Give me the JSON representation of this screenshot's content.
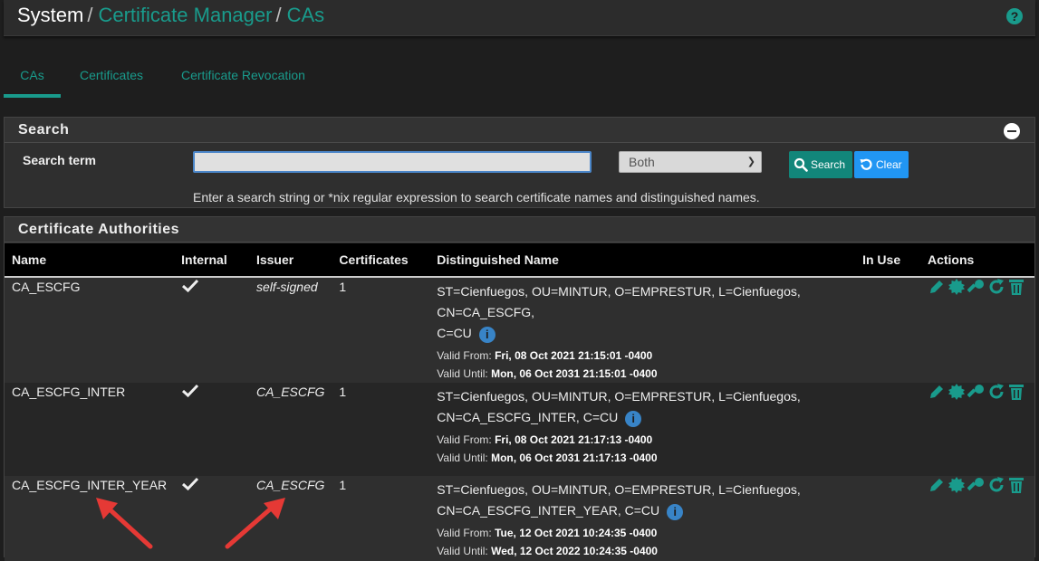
{
  "breadcrumb": {
    "root": "System",
    "sep1": "/",
    "item1": "Certificate Manager",
    "sep2": "/",
    "item2": "CAs"
  },
  "tabs": [
    {
      "label": "CAs",
      "active": true
    },
    {
      "label": "Certificates",
      "active": false
    },
    {
      "label": "Certificate Revocation",
      "active": false
    }
  ],
  "search": {
    "title": "Search",
    "label": "Search term",
    "value": "",
    "select_value": "Both",
    "search_button": "Search",
    "clear_button": "Clear",
    "help": "Enter a search string or *nix regular expression to search certificate names and distinguished names."
  },
  "ca_panel": {
    "title": "Certificate Authorities",
    "columns": [
      "Name",
      "Internal",
      "Issuer",
      "Certificates",
      "Distinguished Name",
      "In Use",
      "Actions"
    ],
    "rows": [
      {
        "name": "CA_ESCFG",
        "internal": true,
        "issuer": "self-signed",
        "certificates": "1",
        "dn_line1": "ST=Cienfuegos, OU=MINTUR, O=EMPRESTUR, L=Cienfuegos, CN=CA_ESCFG,",
        "dn_line2": "C=CU",
        "valid_from_label": "Valid From:",
        "valid_from": "Fri, 08 Oct 2021 21:15:01 -0400",
        "valid_until_label": "Valid Until:",
        "valid_until": "Mon, 06 Oct 2031 21:15:01 -0400"
      },
      {
        "name": "CA_ESCFG_INTER",
        "internal": true,
        "issuer": "CA_ESCFG",
        "certificates": "1",
        "dn_line1": "ST=Cienfuegos, OU=MINTUR, O=EMPRESTUR, L=Cienfuegos,",
        "dn_line2": "CN=CA_ESCFG_INTER, C=CU",
        "valid_from_label": "Valid From:",
        "valid_from": "Fri, 08 Oct 2021 21:17:13 -0400",
        "valid_until_label": "Valid Until:",
        "valid_until": "Mon, 06 Oct 2031 21:17:13 -0400"
      },
      {
        "name": "CA_ESCFG_INTER_YEAR",
        "internal": true,
        "issuer": "CA_ESCFG",
        "certificates": "1",
        "dn_line1": "ST=Cienfuegos, OU=MINTUR, O=EMPRESTUR, L=Cienfuegos,",
        "dn_line2": "CN=CA_ESCFG_INTER_YEAR, C=CU",
        "valid_from_label": "Valid From:",
        "valid_from": "Tue, 12 Oct 2021 10:24:35 -0400",
        "valid_until_label": "Valid Until:",
        "valid_until": "Wed, 12 Oct 2022 10:24:35 -0400"
      }
    ]
  },
  "colors": {
    "accent": "#199b8c",
    "info": "#3884c7",
    "clear": "#2196f3",
    "arrow": "#e53935"
  }
}
